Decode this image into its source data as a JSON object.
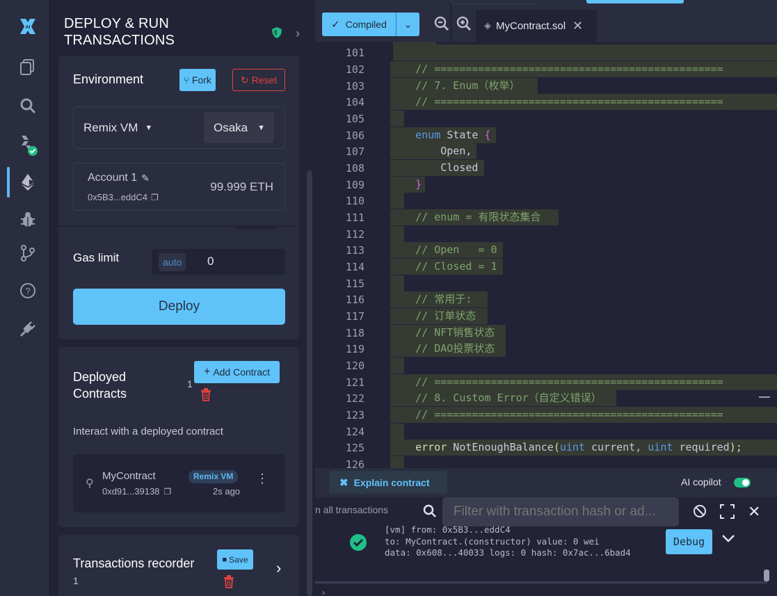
{
  "panel": {
    "title_line1": "DEPLOY & RUN",
    "title_line2": "TRANSACTIONS",
    "environment": {
      "label": "Environment",
      "fork_label": "Fork",
      "reset_label": "Reset",
      "provider": "Remix VM",
      "fork_version": "Osaka"
    },
    "account": {
      "label": "Account 1",
      "address": "0x5B3...eddC4",
      "balance": "99.999 ETH"
    },
    "gas": {
      "label": "Gas limit",
      "auto_label": "auto",
      "value": "0"
    },
    "deploy_label": "Deploy",
    "deployed": {
      "title_line1": "Deployed",
      "title_line2": "Contracts",
      "count": "1",
      "add_label": "Add Contract",
      "hint": "Interact with a deployed contract",
      "contract_name": "MyContract",
      "contract_address": "0xd91...39138",
      "badge": "Remix VM",
      "age": "2s ago"
    },
    "recorder": {
      "title": "Transactions recorder",
      "count": "1",
      "save_label": "Save"
    }
  },
  "editor": {
    "compiled_label": "Compiled",
    "tab_label": "MyContract.sol",
    "line_numbers": [
      "101",
      "102",
      "103",
      "104",
      "105",
      "106",
      "107",
      "108",
      "109",
      "110",
      "111",
      "112",
      "113",
      "114",
      "115",
      "116",
      "117",
      "118",
      "119",
      "120",
      "121",
      "122",
      "123",
      "124",
      "125",
      "126"
    ],
    "lines": {
      "l102": "// ==============================================",
      "l103": "// 7. Enum（枚举）",
      "l104": "// ==============================================",
      "l106a": "enum",
      "l106b": " State ",
      "l106c": "{",
      "l107": "Open,",
      "l108": "Closed",
      "l109": "}",
      "l111": "// enum = 有限状态集合",
      "l113": "// Open   = 0",
      "l114": "// Closed = 1",
      "l116": "// 常用于:",
      "l117": "// 订单状态",
      "l118": "// NFT销售状态",
      "l119": "// DAO投票状态",
      "l121": "// ==============================================",
      "l122": "// 8. Custom Error（自定义错误）",
      "l123": "// ==============================================",
      "l125a": "error",
      "l125b": " NotEnoughBalance",
      "l125c": "(",
      "l125d": "uint",
      "l125e": " current, ",
      "l125f": "uint",
      "l125g": " required",
      "l125h": ");"
    }
  },
  "copilot": {
    "explain_label": "Explain contract",
    "ai_label": "AI copilot"
  },
  "terminal": {
    "listen_label": "n all transactions",
    "filter_placeholder": "Filter with transaction hash or ad...",
    "tx_line1": "[vm]  from: 0x5B3...eddC4",
    "tx_line2": "to: MyContract.(constructor) value: 0 wei",
    "tx_line3": "data: 0x608...40033 logs: 0 hash: 0x7ac...6bad4",
    "debug_label": "Debug"
  },
  "colors": {
    "accent": "#5fc3fa",
    "success": "#1fbf86",
    "danger": "#e0443e",
    "comment": "#7ea46a"
  }
}
